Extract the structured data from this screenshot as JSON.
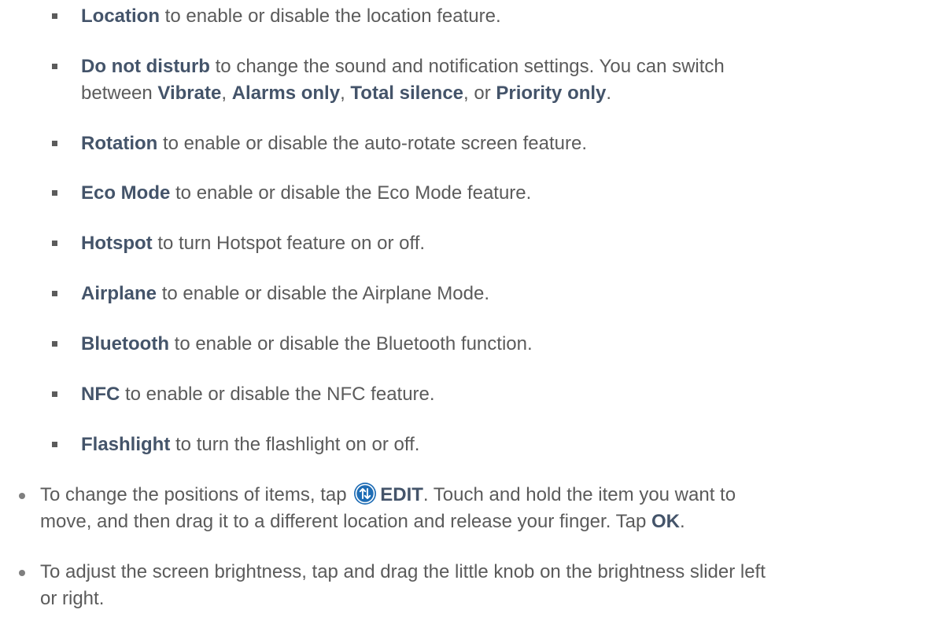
{
  "sub_items": [
    {
      "term": "Location",
      "rest": " to enable or disable the location feature."
    },
    {
      "term": "Do not disturb",
      "rest_line1": " to change the sound and notification settings.  You can switch",
      "line2_prefix": "between ",
      "opt1": "Vibrate",
      "sep1": ", ",
      "opt2": "Alarms only",
      "sep2": ", ",
      "opt3": "Total silence",
      "sep3": ", or ",
      "opt4": "Priority only",
      "end": "."
    },
    {
      "term": "Rotation",
      "rest": " to enable or disable the auto-rotate screen feature."
    },
    {
      "term": "Eco Mode",
      "rest": " to enable or disable the Eco Mode feature."
    },
    {
      "term": "Hotspot",
      "rest": " to turn Hotspot feature on or off."
    },
    {
      "term": "Airplane",
      "rest": " to enable or disable the Airplane Mode."
    },
    {
      "term": "Bluetooth",
      "rest": " to enable or disable the Bluetooth function."
    },
    {
      "term": "NFC",
      "rest": " to enable or disable the NFC feature."
    },
    {
      "term": "Flashlight",
      "rest": " to turn the flashlight on or off."
    }
  ],
  "main_items": [
    {
      "pre": "To change the positions of items, tap ",
      "icon": "edit-arrows-icon",
      "term": "EDIT",
      "mid_line1": ". Touch and hold the item you want to",
      "line2": "move, and then drag it to a different location and release your finger. Tap ",
      "term2": "OK",
      "end": "."
    },
    {
      "line1": "To adjust the screen brightness, tap and drag the little knob on the brightness slider left",
      "line2": "or right."
    }
  ],
  "colors": {
    "text": "#5b5b5b",
    "bold": "#44546a",
    "icon": "#1f6db5"
  }
}
